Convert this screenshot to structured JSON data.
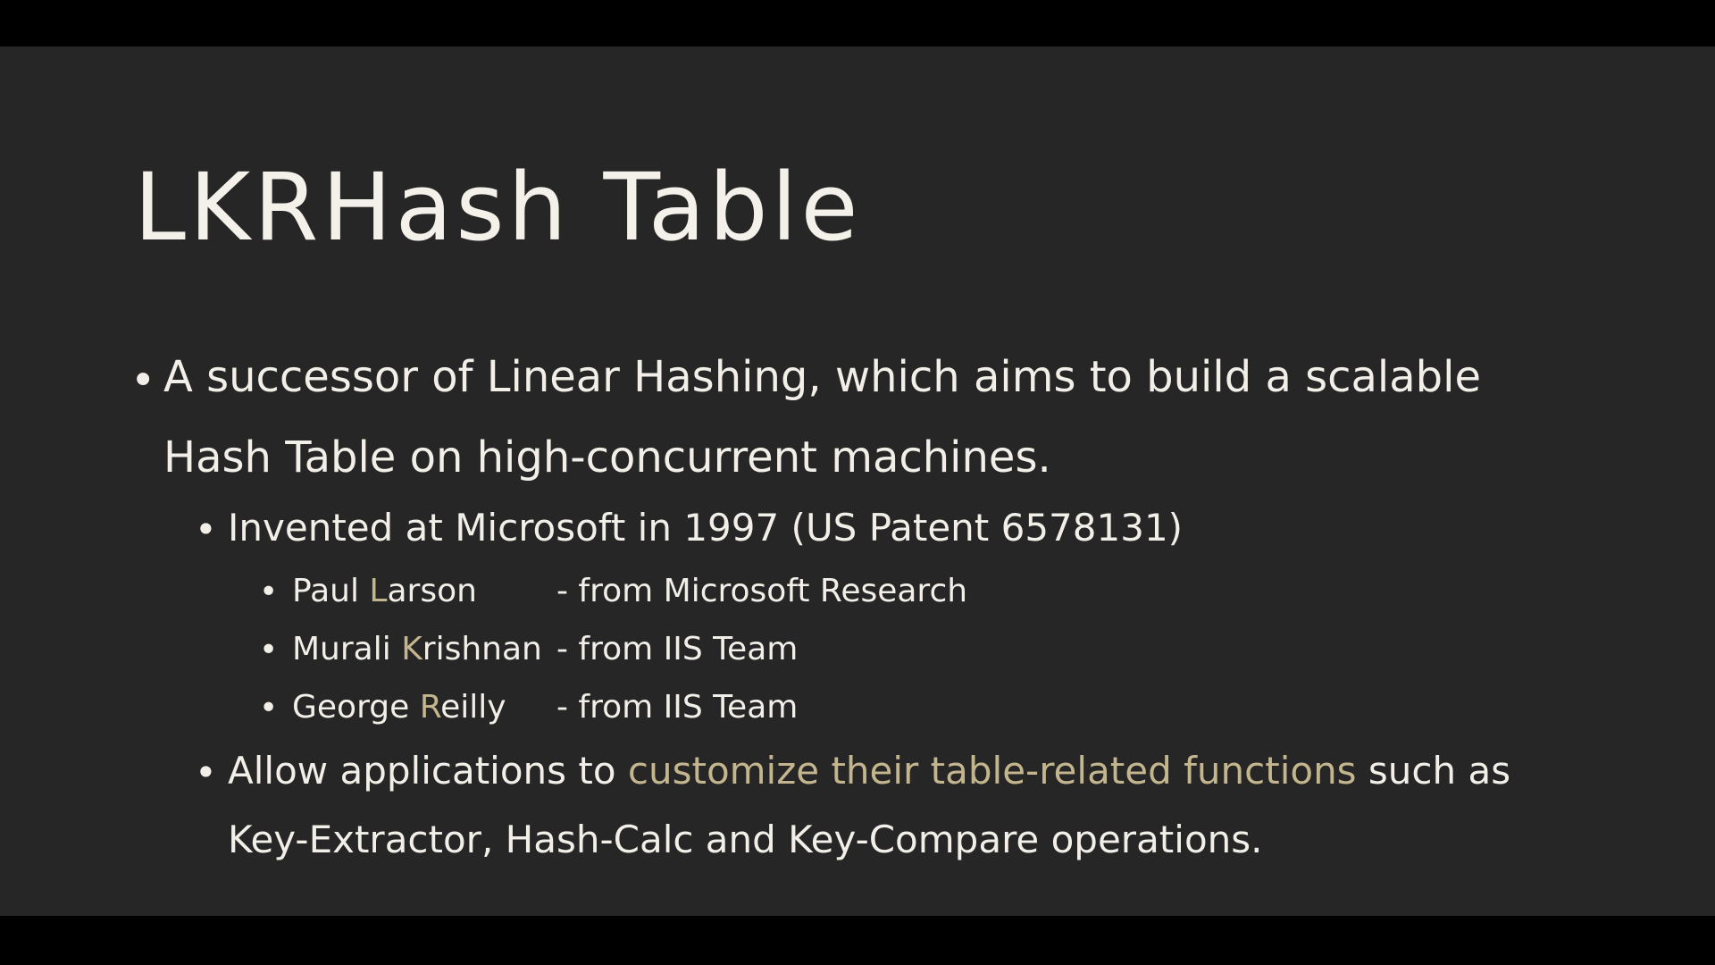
{
  "slide": {
    "title": "LKRHash Table",
    "bullet1": {
      "line1": "A successor of Linear Hashing, which aims to build a scalable",
      "line2": "Hash Table on high-concurrent machines."
    },
    "bullet2": {
      "text": "Invented at Microsoft in 1997 (US Patent 6578131)"
    },
    "authors": [
      {
        "first": "Paul ",
        "initial": "L",
        "rest": "arson",
        "affiliation": "- from Microsoft Research"
      },
      {
        "first": "Murali ",
        "initial": "K",
        "rest": "rishnan",
        "affiliation": "- from IIS Team"
      },
      {
        "first": "George ",
        "initial": "R",
        "rest": "eilly",
        "affiliation": "- from IIS Team"
      }
    ],
    "bullet3": {
      "before": "Allow applications to ",
      "highlight": "customize their table-related functions",
      "after": " such as",
      "line2": "Key-Extractor, Hash-Calc and Key-Compare operations."
    },
    "bullet_glyph": "•",
    "colors": {
      "background": "#262626",
      "frame": "#000000",
      "text": "#f2efe8",
      "accent": "#c3b58d"
    }
  }
}
